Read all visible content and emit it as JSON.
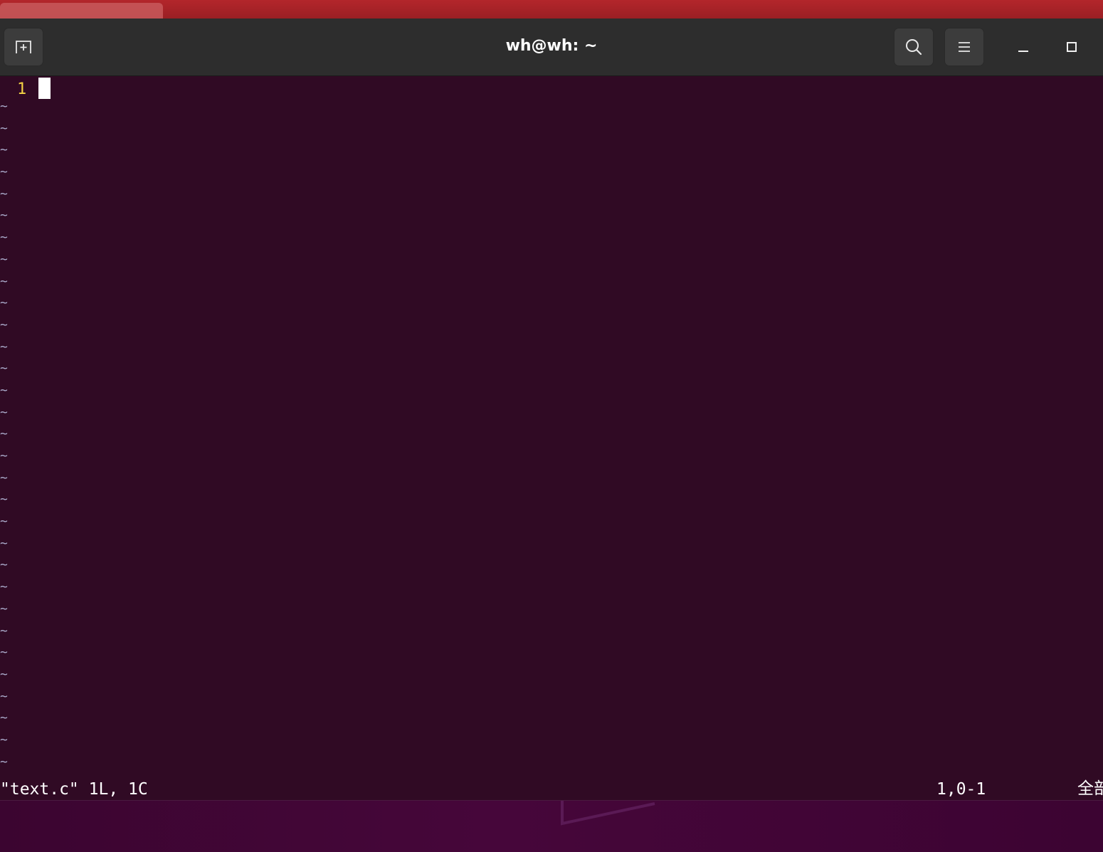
{
  "window": {
    "title": "wh@wh: ~"
  },
  "icons": {
    "new_tab": "new-tab-icon",
    "search": "search-icon",
    "menu": "hamburger-menu-icon",
    "minimize": "minimize-icon",
    "maximize": "maximize-icon"
  },
  "editor": {
    "line_number": "1",
    "empty_line_marker": "~"
  },
  "status": {
    "file_info": "\"text.c\" 1L, 1C",
    "cursor_position": "1,0-1",
    "scroll_position": "全部"
  },
  "colors": {
    "terminal_bg": "#300a24",
    "header_bg": "#2d2d2d",
    "line_number": "#f5d445",
    "tilde": "#a9a9c9"
  }
}
